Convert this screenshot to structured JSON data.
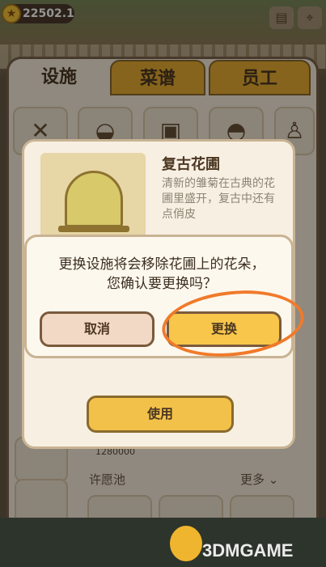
{
  "currency": {
    "icon": "star-coin-icon",
    "value": "22502.1"
  },
  "tabs": [
    {
      "label": "设施",
      "active": true
    },
    {
      "label": "菜谱",
      "active": false
    },
    {
      "label": "员工",
      "active": false
    }
  ],
  "background": {
    "price": "1280000",
    "section_title": "许愿池",
    "more_label": "更多"
  },
  "detail_dialog": {
    "title": "复古花圃",
    "description": "清新的雏菊在古典的花圃里盛开，复古中还有点俏皮",
    "use_button": "使用"
  },
  "confirm_dialog": {
    "message": "更换设施将会移除花圃上的花朵，您确认要更换吗？",
    "cancel_button": "取消",
    "confirm_button": "更换"
  },
  "watermark": "3DMGAME",
  "colors": {
    "accent": "#f2c14a",
    "highlight": "#f07a2a",
    "panel": "#f6eddc"
  }
}
